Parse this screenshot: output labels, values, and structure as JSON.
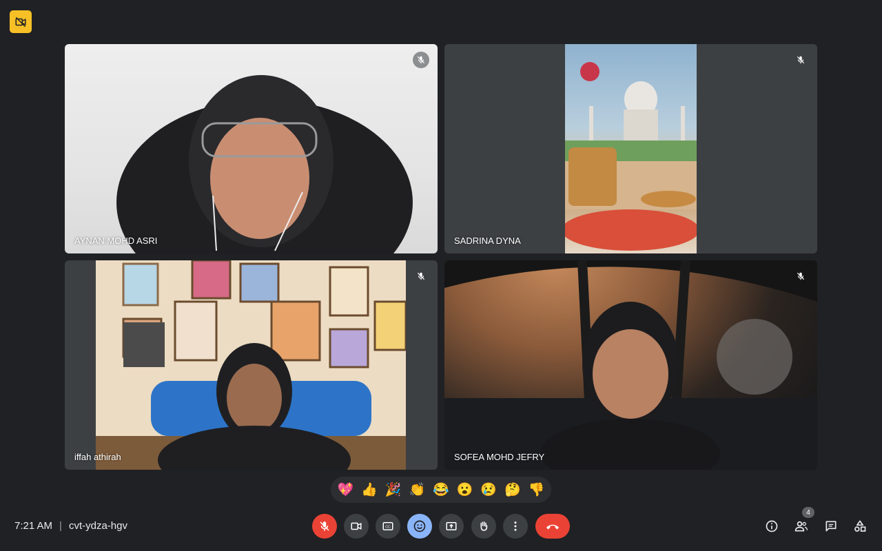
{
  "top_badge": {
    "icon": "video-off-icon",
    "color": "#f6c026"
  },
  "participants": [
    {
      "name": "AYNAN MOHD ASRI",
      "muted": true
    },
    {
      "name": "SADRINA DYNA",
      "muted": true
    },
    {
      "name": "iffah athirah",
      "muted": true
    },
    {
      "name": "SOFEA MOHD JEFRY",
      "muted": true
    }
  ],
  "reactions": [
    "💖",
    "👍",
    "🎉",
    "👏",
    "😂",
    "😮",
    "😢",
    "🤔",
    "👎"
  ],
  "meeting": {
    "time": "7:21 AM",
    "separator": "|",
    "code": "cvt-ydza-hgv"
  },
  "controls": {
    "mic": "mic-off-icon",
    "camera": "camera-icon",
    "captions": "captions-icon",
    "emoji": "emoji-icon",
    "present": "present-icon",
    "raise_hand": "hand-icon",
    "more": "more-vert-icon",
    "leave": "hang-up-icon"
  },
  "right_controls": {
    "people_count": "4"
  },
  "colors": {
    "background": "#202124",
    "tile": "#3c4043",
    "red": "#ea4335",
    "blue": "#8ab4f8"
  }
}
